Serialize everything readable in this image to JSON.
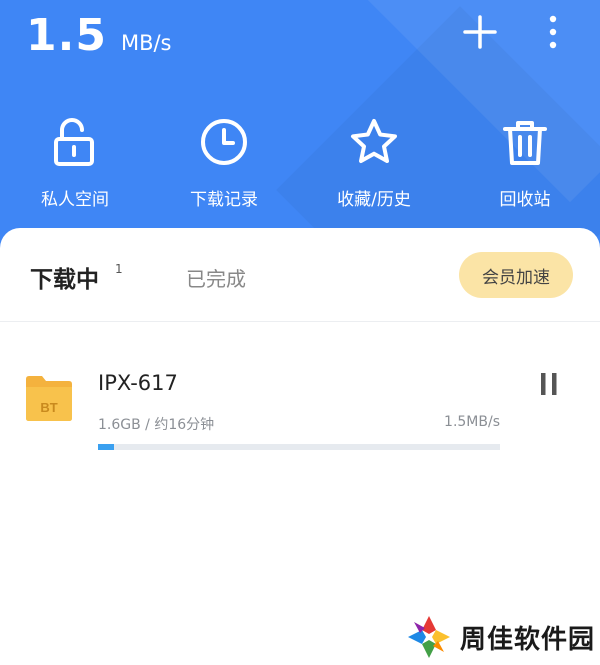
{
  "header": {
    "speed_value": "1.5",
    "speed_unit": "MB/s",
    "background_color": "#3f86f5",
    "actions": [
      {
        "name": "add",
        "icon": "plus-icon"
      },
      {
        "name": "more",
        "icon": "more-vertical-icon"
      }
    ]
  },
  "quick_actions": [
    {
      "label": "私人空间",
      "icon": "unlock-icon"
    },
    {
      "label": "下载记录",
      "icon": "clock-icon"
    },
    {
      "label": "收藏/历史",
      "icon": "star-icon"
    },
    {
      "label": "回收站",
      "icon": "trash-icon"
    }
  ],
  "tabs": {
    "active_label": "下载中",
    "active_count": "1",
    "inactive_label": "已完成"
  },
  "vip_button": {
    "label": "会员加速",
    "color": "#fbe4a6"
  },
  "downloads": [
    {
      "name": "IPX-617",
      "icon": "bt-folder-icon",
      "icon_text": "BT",
      "meta": "1.6GB / 约16分钟",
      "speed": "1.5MB/s",
      "progress": 0.04,
      "progress_color": "#3aa0f0"
    }
  ],
  "watermark": {
    "text": "周佳软件园"
  }
}
